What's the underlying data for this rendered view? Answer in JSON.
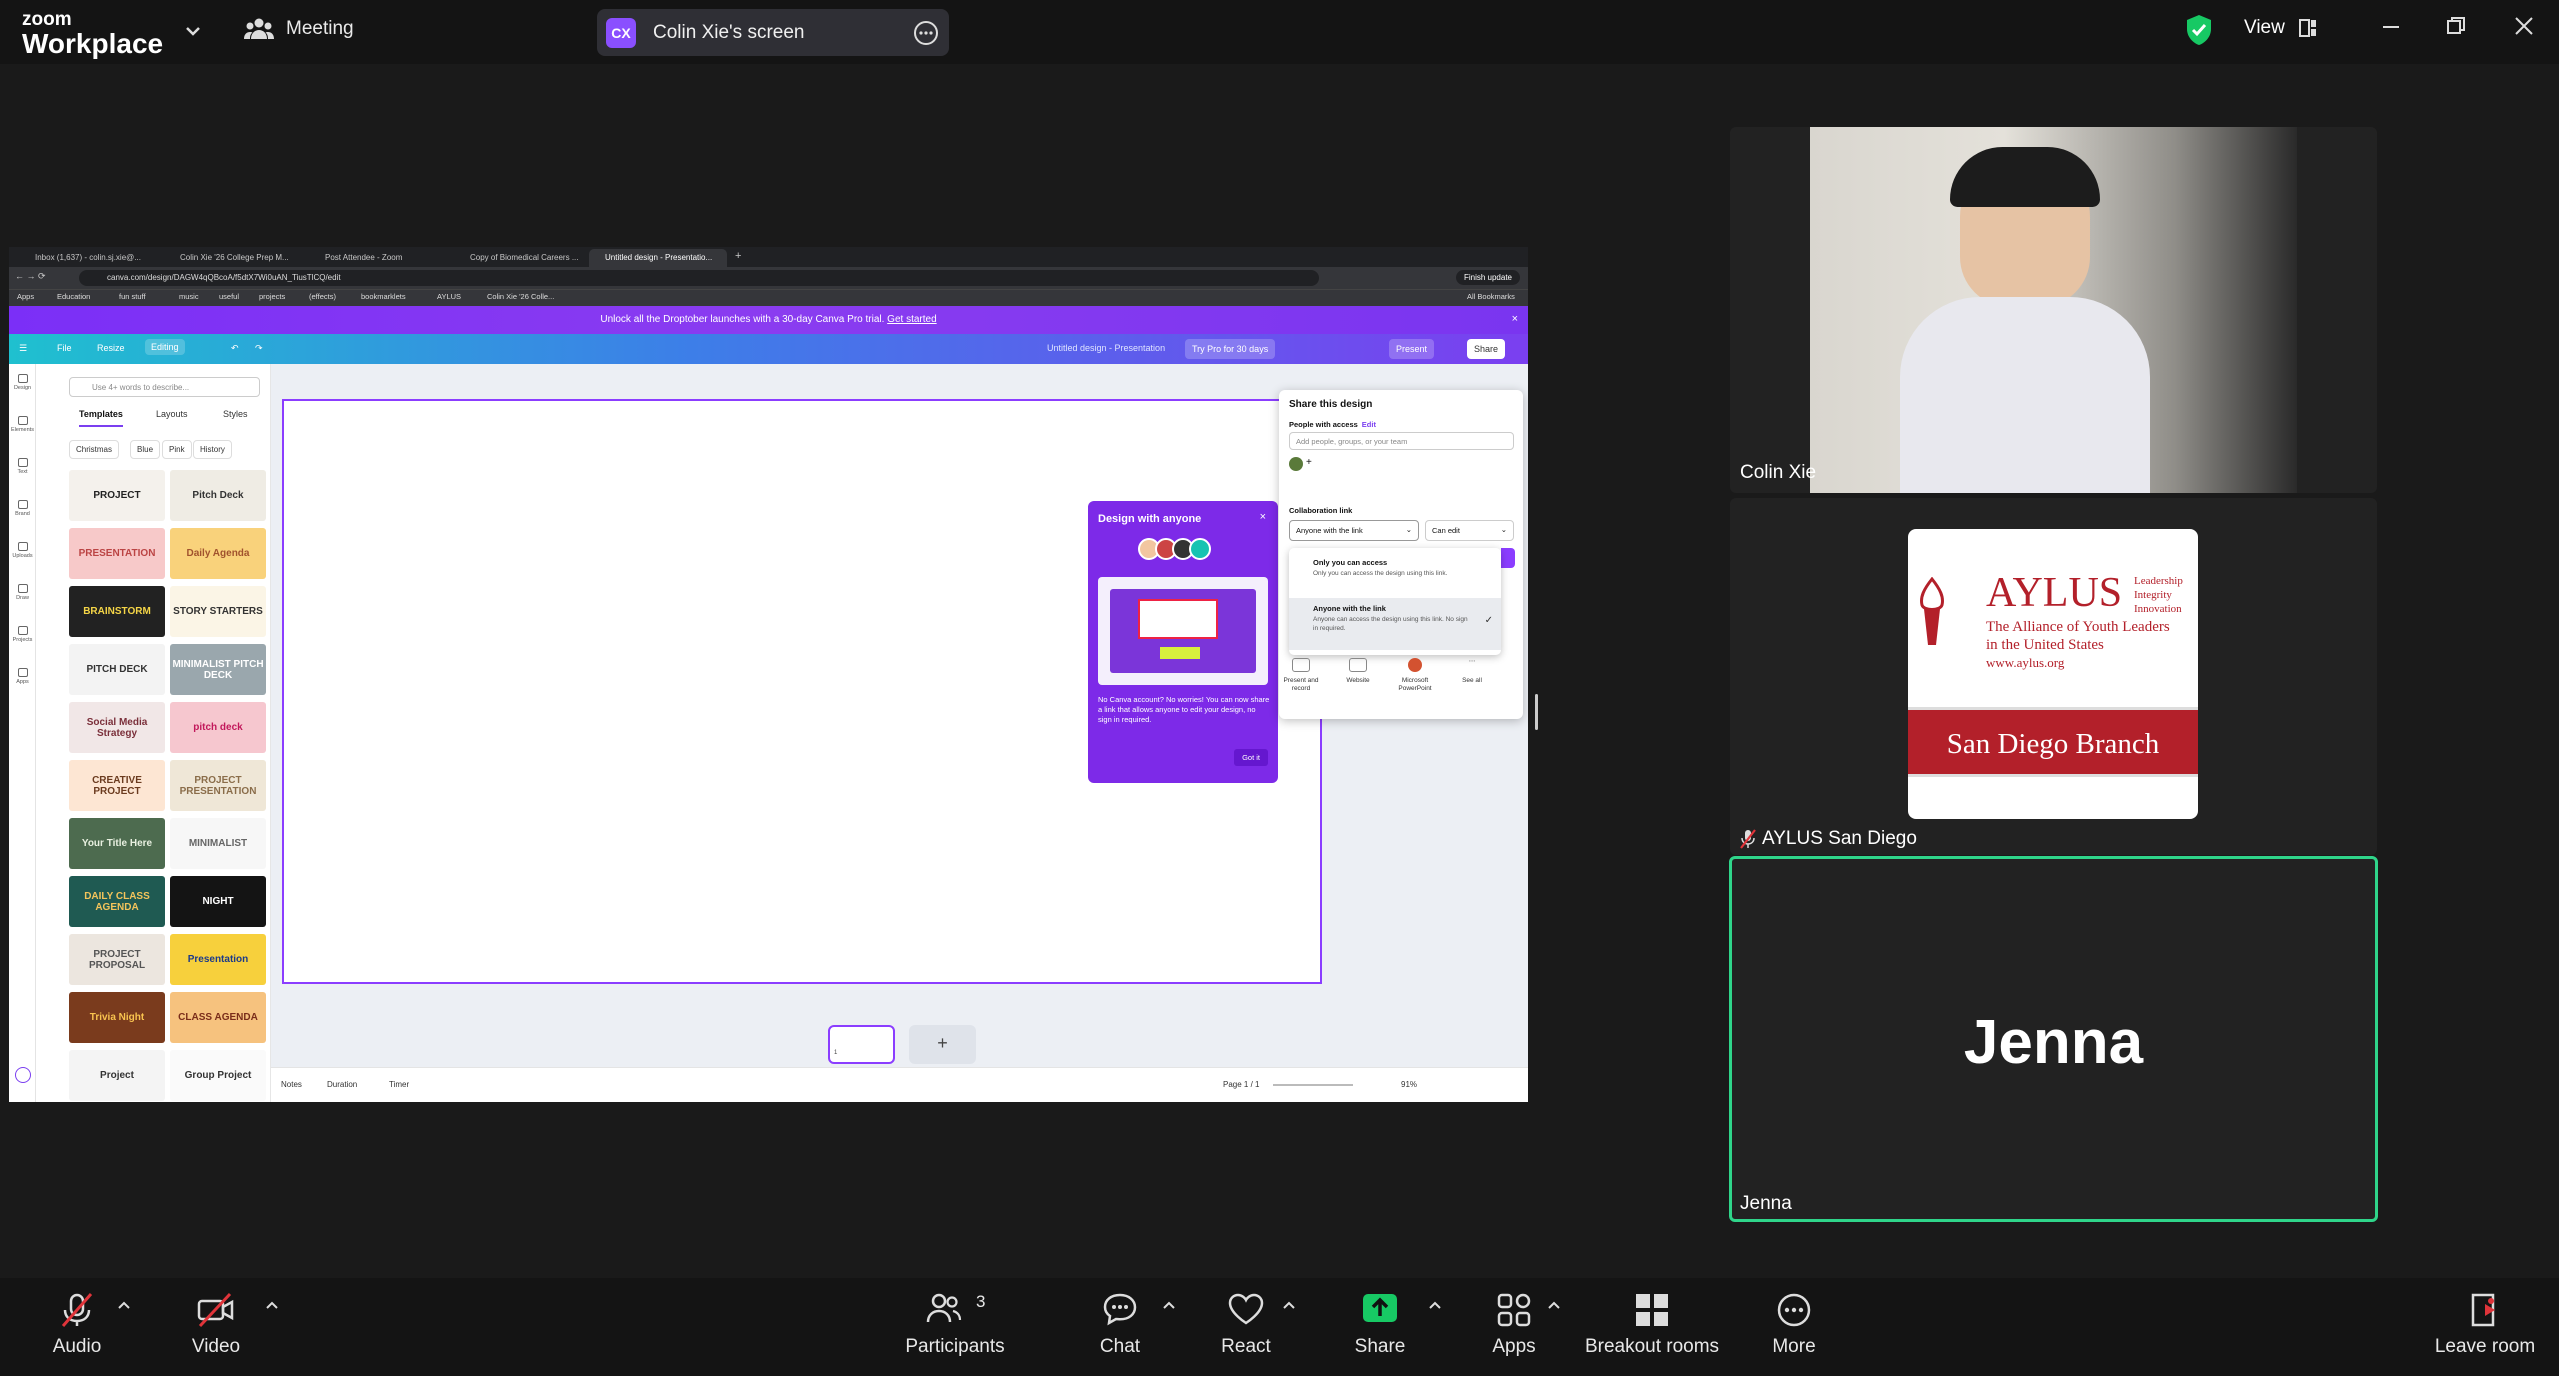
{
  "app": {
    "brand_top": "zoom",
    "brand_bottom": "Workplace",
    "meeting_label": "Meeting"
  },
  "screen_share": {
    "initials": "CX",
    "label": "Colin Xie's screen"
  },
  "topbar": {
    "view_label": "View"
  },
  "browser": {
    "tabs": [
      "Inbox (1,637) - colin.sj.xie@...",
      "Colin Xie '26 College Prep M...",
      "Post Attendee - Zoom",
      "Copy of Biomedical Careers ...",
      "Untitled design - Presentatio..."
    ],
    "url": "canva.com/design/DAGW4qQBcoA/f5dtX7Wi0uAN_TiusTlCQ/edit",
    "finish_update": "Finish update",
    "bookmarks": [
      "Apps",
      "Education",
      "fun stuff",
      "music",
      "useful",
      "projects",
      "(effects)",
      "bookmarklets",
      "AYLUS",
      "Colin Xie '26 Colle...",
      "All Bookmarks"
    ]
  },
  "canva": {
    "promo_text": "Unlock all the Droptober launches with a 30-day Canva Pro trial.",
    "promo_link": "Get started",
    "header": {
      "file": "File",
      "resize": "Resize",
      "editing": "Editing",
      "title": "Untitled design - Presentation",
      "try_pro": "Try Pro for 30 days",
      "present": "Present",
      "share": "Share"
    },
    "rail": [
      "Design",
      "Elements",
      "Text",
      "Brand",
      "Uploads",
      "Draw",
      "Projects",
      "Apps"
    ],
    "search_placeholder": "Use 4+ words to describe...",
    "panel_tabs": [
      "Templates",
      "Layouts",
      "Styles"
    ],
    "chips": [
      "Christmas",
      "Blue",
      "Pink",
      "History"
    ],
    "templates": [
      {
        "label": "PROJECT",
        "bg": "#f4f1ec",
        "fg": "#222"
      },
      {
        "label": "Pitch Deck",
        "bg": "#efece4",
        "fg": "#333"
      },
      {
        "label": "PRESENTATION",
        "bg": "#f7c9c9",
        "fg": "#b44"
      },
      {
        "label": "Daily Agenda",
        "bg": "#f9d27b",
        "fg": "#a0522d"
      },
      {
        "label": "BRAINSTORM",
        "bg": "#222",
        "fg": "#f5d547"
      },
      {
        "label": "STORY STARTERS",
        "bg": "#fbf5e6",
        "fg": "#333"
      },
      {
        "label": "PITCH DECK",
        "bg": "#f3f3f3",
        "fg": "#333"
      },
      {
        "label": "MINIMALIST PITCH DECK",
        "bg": "#9aa7ad",
        "fg": "#fff"
      },
      {
        "label": "Social Media Strategy",
        "bg": "#f1e7e7",
        "fg": "#7a2f3a"
      },
      {
        "label": "pitch deck",
        "bg": "#f6c7cf",
        "fg": "#c2185b"
      },
      {
        "label": "CREATIVE PROJECT",
        "bg": "#fde6d3",
        "fg": "#6b3b1f"
      },
      {
        "label": "PROJECT PRESENTATION",
        "bg": "#efe7d7",
        "fg": "#8a6d4a"
      },
      {
        "label": "Your Title Here",
        "bg": "#4d6b4f",
        "fg": "#e8f0e0"
      },
      {
        "label": "MINIMALIST",
        "bg": "#f7f7f7",
        "fg": "#666"
      },
      {
        "label": "DAILY CLASS AGENDA",
        "bg": "#1f5a52",
        "fg": "#f4c45b"
      },
      {
        "label": "NIGHT",
        "bg": "#141414",
        "fg": "#fff"
      },
      {
        "label": "PROJECT PROPOSAL",
        "bg": "#ece6df",
        "fg": "#555"
      },
      {
        "label": "Presentation",
        "bg": "#f7d03c",
        "fg": "#1b3a8a"
      },
      {
        "label": "Trivia Night",
        "bg": "#7a3b1d",
        "fg": "#f9c44f"
      },
      {
        "label": "CLASS AGENDA",
        "bg": "#f6c27e",
        "fg": "#7a2d1a"
      },
      {
        "label": "Project",
        "bg": "#f4f4f4",
        "fg": "#333"
      },
      {
        "label": "Group Project",
        "bg": "#fafafa",
        "fg": "#333"
      }
    ],
    "design_with_anyone": {
      "title": "Design with anyone",
      "body": "No Canva account? No worries! You can now share a link that allows anyone to edit your design, no sign in required.",
      "button": "Got it"
    },
    "share_panel": {
      "title": "Share this design",
      "people_with_access": "People with access",
      "edit": "Edit",
      "input_placeholder": "Add people, groups, or your team",
      "collaboration_link": "Collaboration link",
      "link_option": "Anyone with the link",
      "permission": "Can edit",
      "options": [
        {
          "title": "Only you can access",
          "desc": "Only you can access the design using this link."
        },
        {
          "title": "Anyone with the link",
          "desc": "Anyone can access the design using this link. No sign in required."
        }
      ],
      "share_icons": [
        "Present and record",
        "Website",
        "Microsoft PowerPoint",
        "See all"
      ]
    },
    "page_number": "1",
    "footer": {
      "notes": "Notes",
      "duration": "Duration",
      "timer": "Timer",
      "page": "Page 1 / 1",
      "zoom": "91%"
    }
  },
  "participants": [
    {
      "name": "Colin Xie"
    },
    {
      "name": "AYLUS San Diego",
      "logo_title": "AYLUS",
      "logo_tagline": [
        "Leadership",
        "Integrity",
        "Innovation"
      ],
      "logo_sub": [
        "The Alliance of Youth Leaders",
        "in the United States",
        "www.aylus.org"
      ],
      "logo_branch": "San Diego Branch"
    },
    {
      "name": "Jenna",
      "display_name": "Jenna"
    }
  ],
  "toolbar": {
    "audio": "Audio",
    "video": "Video",
    "participants": "Participants",
    "participants_count": "3",
    "chat": "Chat",
    "react": "React",
    "share": "Share",
    "apps": "Apps",
    "breakout": "Breakout rooms",
    "more": "More",
    "leave": "Leave room"
  },
  "colors": {
    "zoom_bg": "#1a1a1a",
    "active_speaker": "#2fd58a",
    "share_green": "#17c964",
    "mute_red": "#e0343a",
    "canva_purple": "#7d2ae8"
  }
}
